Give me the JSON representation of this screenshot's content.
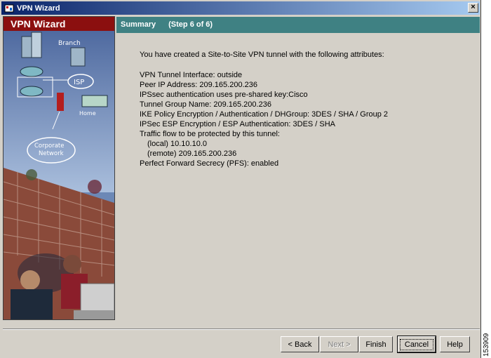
{
  "window": {
    "title": "VPN Wizard",
    "close_glyph": "×"
  },
  "side_panel": {
    "title": "VPN Wizard",
    "labels": {
      "branch": "Branch",
      "isp": "ISP",
      "home": "Home",
      "corporate_line1": "Corporate",
      "corporate_line2": "Network"
    }
  },
  "header": {
    "title": "Summary",
    "step": "(Step 6 of 6)"
  },
  "summary": {
    "intro": "You have created a Site-to-Site VPN tunnel with the following attributes:",
    "lines": [
      "VPN Tunnel Interface: outside",
      "Peer IP Address: 209.165.200.236",
      "IPSsec authentication uses pre-shared key:Cisco",
      "Tunnel Group Name: 209.165.200.236",
      "IKE Policy Encryption / Authentication / DHGroup: 3DES / SHA / Group 2",
      "IPSec ESP Encryption / ESP Authentication: 3DES / SHA",
      "Traffic flow to be protected by this tunnel:",
      "(local) 10.10.10.0",
      "(remote) 209.165.200.236",
      "Perfect Forward Secrecy (PFS): enabled"
    ]
  },
  "buttons": {
    "back": "< Back",
    "next": "Next >",
    "finish": "Finish",
    "cancel": "Cancel",
    "help": "Help"
  },
  "figure_id": "153909",
  "colors": {
    "header_teal": "#3f8183",
    "side_header_red": "#8b0f0f",
    "dialog_gray": "#d4d0c8"
  },
  "icons": {
    "app": "vpn-app-icon",
    "close": "close-icon"
  }
}
